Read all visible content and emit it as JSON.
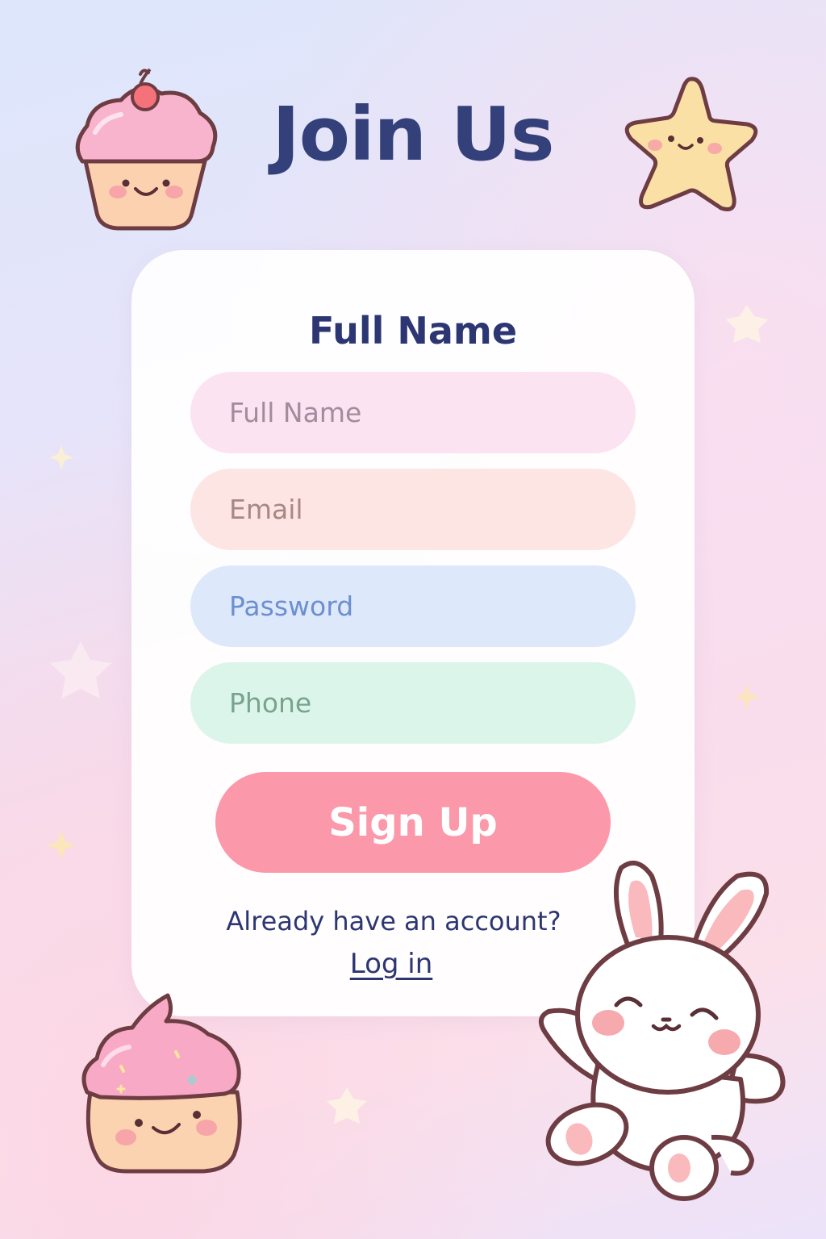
{
  "header": {
    "title": "Join Us"
  },
  "form": {
    "heading": "Full Name",
    "fields": {
      "full_name": {
        "placeholder": "Full Name",
        "value": ""
      },
      "email": {
        "placeholder": "Email",
        "value": ""
      },
      "password": {
        "placeholder": "Password",
        "value": ""
      },
      "phone": {
        "placeholder": "Phone",
        "value": ""
      }
    },
    "submit_label": "Sign Up"
  },
  "footer": {
    "prompt": "Already have an account?",
    "login_label": "Log in"
  },
  "colors": {
    "title": "#33407a",
    "button": "#fb98a9",
    "field_name": "#fbe3f1",
    "field_email": "#fce5e3",
    "field_password": "#dde9fb",
    "field_phone": "#dcf5ea"
  },
  "icons": [
    "cupcake-icon",
    "star-icon",
    "bunny-icon",
    "sparkle-icon"
  ]
}
